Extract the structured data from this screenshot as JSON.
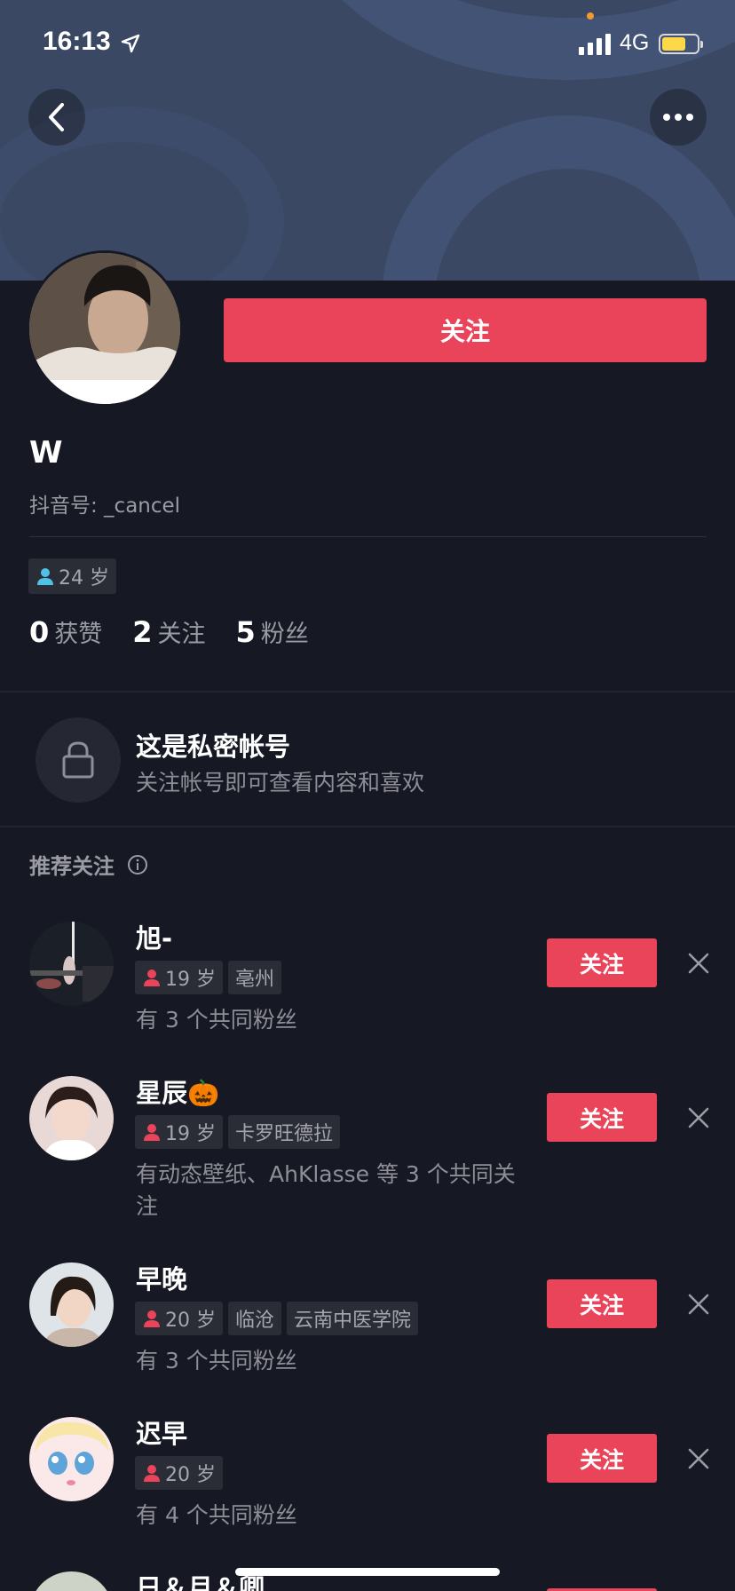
{
  "status_bar": {
    "time": "16:13",
    "network": "4G",
    "battery_level": 0.55,
    "battery_color": "#ffd84a"
  },
  "header": {
    "back_icon": "chevron-left-icon",
    "more_icon": "more-dots-icon"
  },
  "profile": {
    "follow_label": "关注",
    "nickname": "W",
    "douyin_id": "抖音号: _cancel",
    "age_tag": "24 岁",
    "stats": [
      {
        "num": "0",
        "label": "获赞"
      },
      {
        "num": "2",
        "label": "关注"
      },
      {
        "num": "5",
        "label": "粉丝"
      }
    ]
  },
  "private_notice": {
    "title": "这是私密帐号",
    "subtitle": "关注帐号即可查看内容和喜欢"
  },
  "recommend": {
    "title": "推荐关注",
    "follow_label": "关注",
    "items": [
      {
        "name": "旭-",
        "tags": [
          "19 岁",
          "亳州"
        ],
        "desc": "有 3 个共同粉丝"
      },
      {
        "name": "星辰🎃",
        "tags": [
          "19 岁",
          "卡罗旺德拉"
        ],
        "desc": "有动态壁纸、AhKlasse 等 3 个共同关注"
      },
      {
        "name": "早晚",
        "tags": [
          "20 岁",
          "临沧",
          "云南中医学院"
        ],
        "desc": "有 3 个共同粉丝"
      },
      {
        "name": "迟早",
        "tags": [
          "20 岁"
        ],
        "desc": "有 4 个共同粉丝"
      },
      {
        "name": "日＆月＆卿",
        "tags": [],
        "desc": ""
      }
    ]
  },
  "colors": {
    "accent": "#ea445a",
    "background": "#161823",
    "male_icon": "#4fc1e9",
    "female_icon": "#ea445a"
  }
}
